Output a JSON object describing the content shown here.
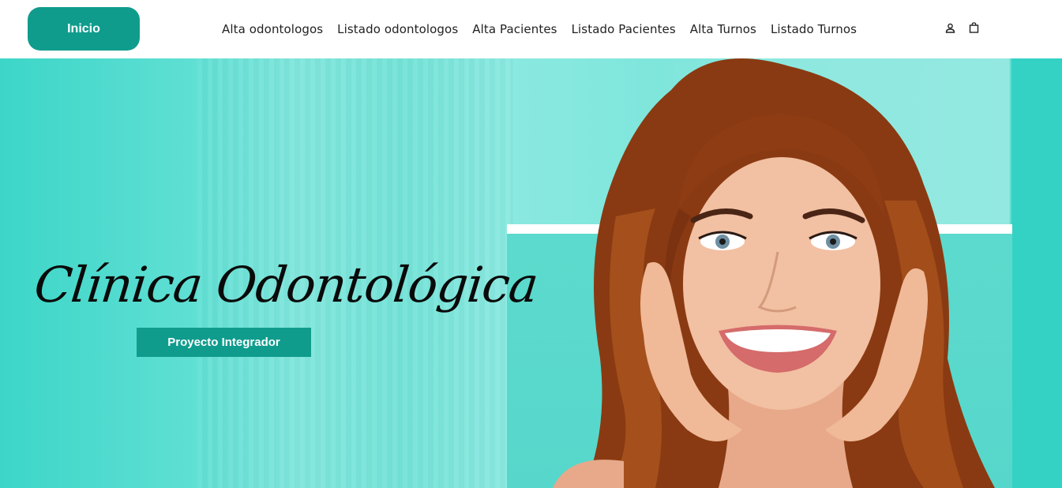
{
  "header": {
    "home_label": "Inicio",
    "nav": [
      {
        "label": "Alta odontologos"
      },
      {
        "label": "Listado odontologos"
      },
      {
        "label": "Alta Pacientes"
      },
      {
        "label": "Listado Pacientes"
      },
      {
        "label": "Alta Turnos"
      },
      {
        "label": "Listado Turnos"
      }
    ],
    "icons": [
      "user-icon",
      "shopping-bag-icon"
    ]
  },
  "hero": {
    "title": "Clínica Odontológica",
    "cta_label": "Proyecto Integrador",
    "image": "smiling-woman-portrait"
  },
  "colors": {
    "accent": "#0f9c8d",
    "hero_teal": "#5fdfd3",
    "hero_band": "#33d2c5",
    "text": "#222222"
  }
}
